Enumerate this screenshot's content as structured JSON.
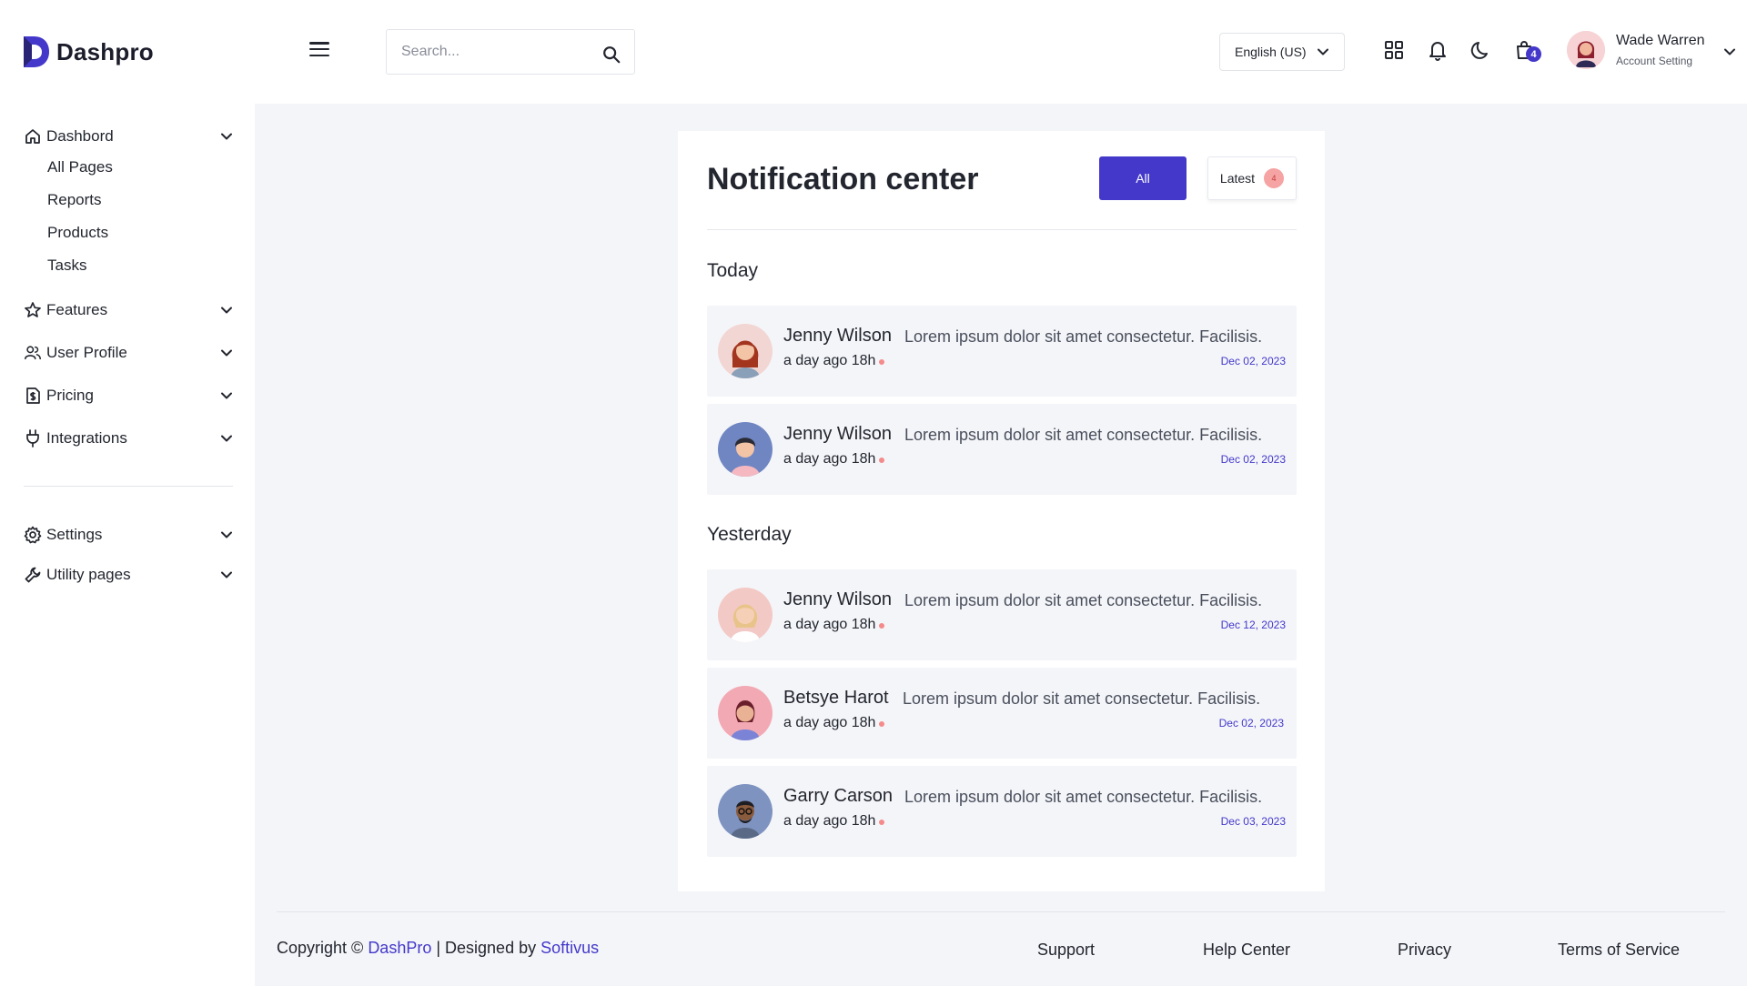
{
  "brand": {
    "name": "Dashpro",
    "accent": "#4338ca"
  },
  "header": {
    "search_placeholder": "Search...",
    "language": "English (US)",
    "cart_count": "4",
    "user": {
      "name": "Wade Warren",
      "subtitle": "Account Setting"
    },
    "icons": [
      "menu-icon",
      "search-icon",
      "grid-icon",
      "bell-icon",
      "moon-icon",
      "cart-icon",
      "chevron-down-icon"
    ]
  },
  "sidebar": {
    "dashboard": {
      "label": "Dashbord",
      "icon": "home-icon"
    },
    "dashboard_sub": [
      "All Pages",
      "Reports",
      "Products",
      "Tasks"
    ],
    "items": [
      {
        "label": "Features",
        "icon": "star-icon"
      },
      {
        "label": "User Profile",
        "icon": "users-icon"
      },
      {
        "label": "Pricing",
        "icon": "dollar-doc-icon"
      },
      {
        "label": "Integrations",
        "icon": "plug-icon"
      }
    ],
    "bottom_items": [
      {
        "label": "Settings",
        "icon": "gear-icon"
      },
      {
        "label": "Utility pages",
        "icon": "wrench-icon"
      }
    ]
  },
  "notification_center": {
    "title": "Notification center",
    "tabs": {
      "all": "All",
      "latest": "Latest",
      "latest_count": "4"
    },
    "groups": [
      {
        "label": "Today",
        "items": [
          {
            "name": "Jenny Wilson",
            "message": "Lorem ipsum dolor sit amet consectetur. Facilisis.",
            "time": "a day ago 18h",
            "date": "Dec 02, 2023",
            "avatar": "avatar-woman-redhair"
          },
          {
            "name": "Jenny Wilson",
            "message": "Lorem ipsum dolor sit amet consectetur. Facilisis.",
            "time": "a day ago 18h",
            "date": "Dec 02, 2023",
            "avatar": "avatar-man-blue"
          }
        ]
      },
      {
        "label": "Yesterday",
        "items": [
          {
            "name": "Jenny Wilson",
            "message": "Lorem ipsum dolor sit amet consectetur. Facilisis.",
            "time": "a day ago 18h",
            "date": "Dec 12, 2023",
            "avatar": "avatar-woman-blonde"
          },
          {
            "name": "Betsye Harot",
            "message": "Lorem ipsum dolor sit amet consectetur. Facilisis.",
            "time": "a day ago 18h",
            "date": "Dec 02, 2023",
            "avatar": "avatar-woman-pink"
          },
          {
            "name": "Garry Carson",
            "message": "Lorem ipsum dolor sit amet consectetur. Facilisis.",
            "time": "a day ago 18h",
            "date": "Dec 03, 2023",
            "avatar": "avatar-man-glasses"
          }
        ]
      }
    ]
  },
  "footer": {
    "copyright_prefix": "Copyright © ",
    "brand_link": "DashPro",
    "separator": " | Designed by ",
    "designer_link": "Softivus",
    "links": [
      "Support",
      "Help Center",
      "Privacy",
      "Terms of Service"
    ]
  }
}
